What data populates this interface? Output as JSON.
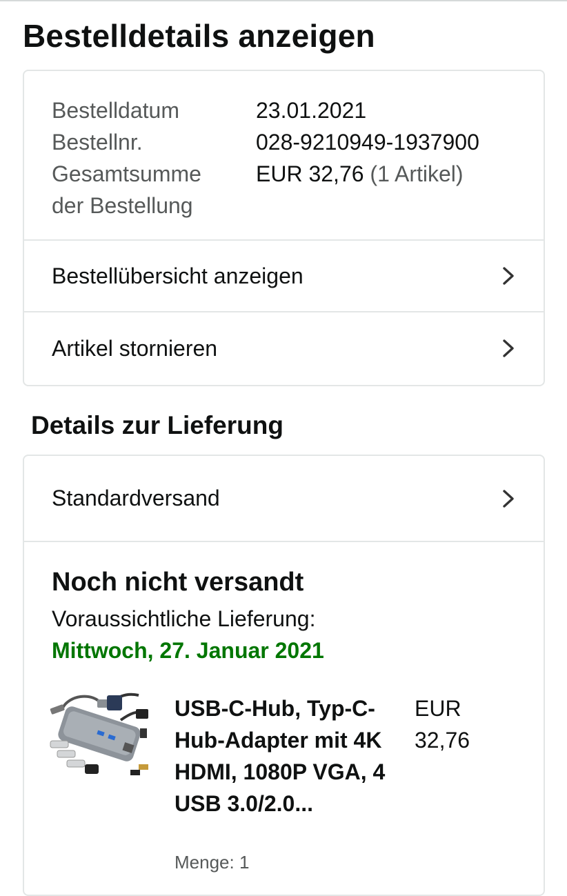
{
  "page": {
    "title": "Bestelldetails anzeigen"
  },
  "order_summary": {
    "date_label": "Bestelldatum",
    "date_value": "23.01.2021",
    "number_label": "Bestellnr.",
    "number_value": "028-9210949-1937900",
    "total_label_line1": "Gesamtsumme",
    "total_label_line2": "der Bestellung",
    "total_value": "EUR 32,76",
    "total_items": "(1 Artikel)"
  },
  "order_links": [
    {
      "label": "Bestellübersicht anzeigen",
      "icon": "chevron-right-icon"
    },
    {
      "label": "Artikel stornieren",
      "icon": "chevron-right-icon"
    }
  ],
  "delivery": {
    "section_title": "Details zur Lieferung",
    "shipping_method": "Standardversand",
    "status": "Noch nicht versandt",
    "eta_label": "Voraussichtliche Lieferung:",
    "eta_date": "Mittwoch, 27. Januar 2021",
    "eta_color": "#007600"
  },
  "item": {
    "image_icon": "usb-c-hub-product-image",
    "title": "USB-C-Hub, Typ-C-Hub-Adapter mit 4K HDMI, 1080P VGA, 4 USB 3.0/2.0...",
    "price": "EUR 32,76",
    "quantity": "Menge: 1"
  }
}
